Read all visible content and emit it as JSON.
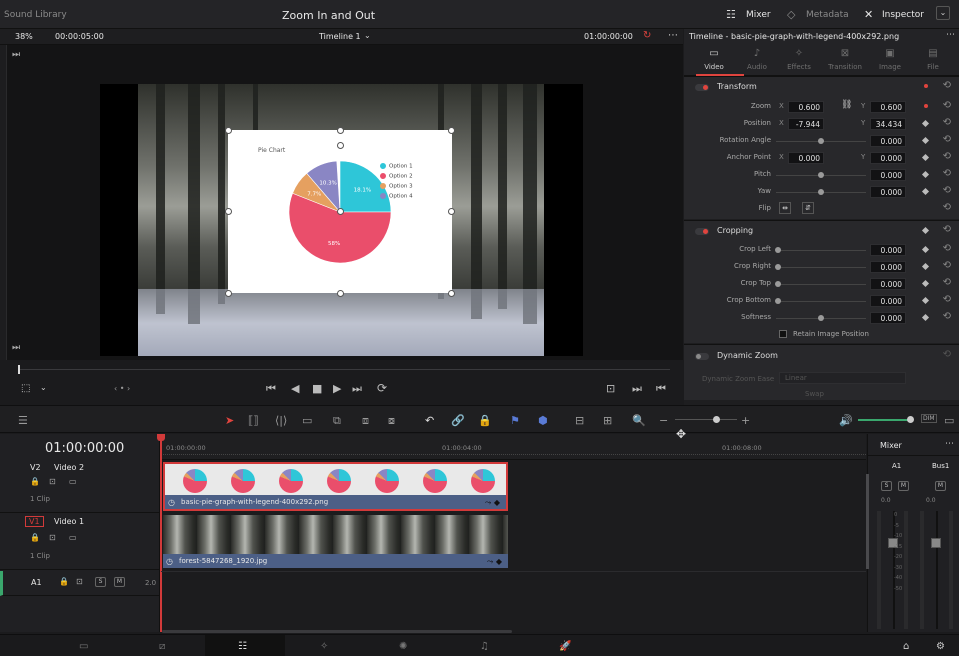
{
  "topbar": {
    "left_panel": "Sound Library",
    "project_title": "Zoom In and Out",
    "mixer": "Mixer",
    "metadata": "Metadata",
    "inspector": "Inspector"
  },
  "viewer_bar": {
    "zoom": "38%",
    "timecode_left": "00:00:05:00",
    "timeline_name": "Timeline 1",
    "timecode_right": "01:00:00:00"
  },
  "inspector": {
    "title": "Timeline - basic-pie-graph-with-legend-400x292.png",
    "tabs": [
      {
        "label": "Video",
        "icon": "video-icon"
      },
      {
        "label": "Audio",
        "icon": "audio-icon"
      },
      {
        "label": "Effects",
        "icon": "effects-icon"
      },
      {
        "label": "Transition",
        "icon": "transition-icon"
      },
      {
        "label": "Image",
        "icon": "image-icon"
      },
      {
        "label": "File",
        "icon": "file-icon"
      }
    ],
    "transform": {
      "title": "Transform",
      "zoom_label": "Zoom",
      "zoom_x": "0.600",
      "zoom_y": "0.600",
      "position_label": "Position",
      "position_x": "-7.944",
      "position_y": "34.434",
      "rotation_label": "Rotation Angle",
      "rotation": "0.000",
      "anchor_label": "Anchor Point",
      "anchor_x": "0.000",
      "anchor_y": "0.000",
      "pitch_label": "Pitch",
      "pitch": "0.000",
      "yaw_label": "Yaw",
      "yaw": "0.000",
      "flip_label": "Flip",
      "x_axis": "X",
      "y_axis": "Y"
    },
    "cropping": {
      "title": "Cropping",
      "left_label": "Crop Left",
      "left": "0.000",
      "right_label": "Crop Right",
      "right": "0.000",
      "top_label": "Crop Top",
      "top": "0.000",
      "bottom_label": "Crop Bottom",
      "bottom": "0.000",
      "softness_label": "Softness",
      "softness": "0.000",
      "retain_label": "Retain Image Position"
    },
    "dynamic_zoom": {
      "title": "Dynamic Zoom",
      "ease_label": "Dynamic Zoom Ease",
      "ease_value": "Linear",
      "swap": "Swap"
    }
  },
  "pie_chart": {
    "title": "Pie Chart",
    "legend": [
      "Option 1",
      "Option 2",
      "Option 3",
      "Option 4"
    ],
    "labels": [
      "18.1%",
      "58%",
      "7.7%",
      "10.3%"
    ],
    "colors": [
      "#2ec6d8",
      "#ea4e6b",
      "#e5a060",
      "#8a86c4"
    ],
    "fractions": [
      0.25,
      0.56,
      0.077,
      0.103
    ]
  },
  "timeline": {
    "timecode": "01:00:00:00",
    "ruler": [
      "01:00:00:00",
      "01:00:04:00",
      "01:00:08:00"
    ],
    "tracks": {
      "v2_id": "V2",
      "v2_name": "Video 2",
      "v2_clips": "1 Clip",
      "v1_id": "V1",
      "v1_name": "Video 1",
      "v1_clips": "1 Clip",
      "a1_id": "A1",
      "a1_level": "2.0"
    },
    "clip_v2": "basic-pie-graph-with-legend-400x292.png",
    "clip_v1": "forest-5847268_1920.jpg"
  },
  "mixer": {
    "title": "Mixer",
    "ch1": "A1",
    "ch2": "Bus1",
    "val1": "0.0",
    "val2": "0.0",
    "scale": [
      "0",
      "-5",
      "-10",
      "-15",
      "-20",
      "-30",
      "-40",
      "-50"
    ]
  },
  "track_buttons": {
    "s": "S",
    "m": "M"
  }
}
